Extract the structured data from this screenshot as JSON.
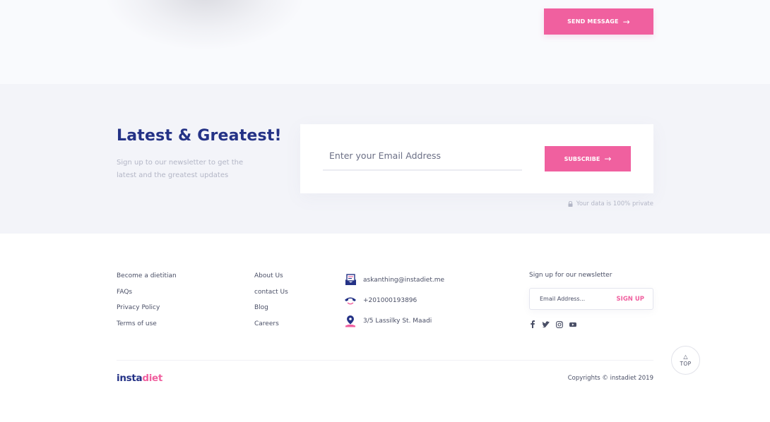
{
  "contact_section": {
    "send_button": "SEND MESSAGE"
  },
  "newsletter": {
    "title": "Latest & Greatest!",
    "description": "Sign up to our newsletter to get the latest and the greatest updates",
    "email_placeholder": "Enter your Email Address",
    "subscribe_button": "SUBSCRIBE",
    "privacy_note": "Your data is 100% private"
  },
  "footer": {
    "links_col1": [
      "Become a dietitian",
      "FAQs",
      "Privacy Policy",
      "Terms of use"
    ],
    "links_col2": [
      "About Us",
      "contact Us",
      "Blog",
      "Careers"
    ],
    "contact": {
      "email": "askanthing@instadiet.me",
      "phone": "+201000193896",
      "address": "3/5 Lassilky St. Maadi"
    },
    "signup": {
      "title": "Sign up for our newsletter",
      "placeholder": "Email Address...",
      "button": "SIGN UP"
    },
    "socials": [
      "facebook-icon",
      "twitter-icon",
      "instagram-icon",
      "youtube-icon"
    ],
    "brand": {
      "part1": "insta",
      "part2": "diet"
    },
    "copyright": "Copyrights © instadiet 2019",
    "top_button": {
      "glyph": "△",
      "label": "TOP"
    }
  },
  "colors": {
    "accent_pink": "#f0609f",
    "brand_navy": "#243286",
    "section_bg": "#f3f4f9"
  }
}
